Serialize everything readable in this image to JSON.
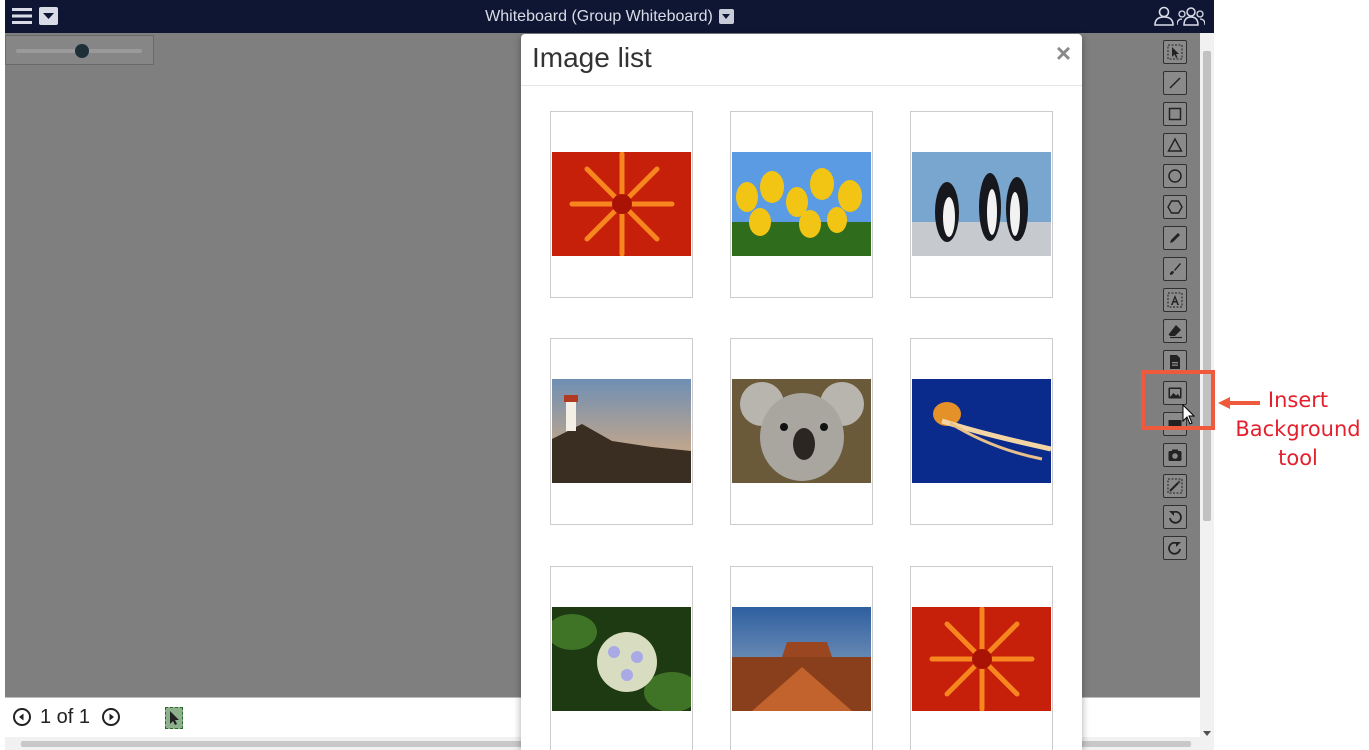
{
  "window": {
    "title": "Whiteboard (Group Whiteboard)"
  },
  "pagination": {
    "label": "1 of 1"
  },
  "zoom": {
    "level": 0.52
  },
  "modal": {
    "title": "Image list",
    "close_glyph": "×",
    "images": [
      {
        "subject": "red dahlia flower"
      },
      {
        "subject": "yellow tulips"
      },
      {
        "subject": "penguins"
      },
      {
        "subject": "lighthouse at sunset"
      },
      {
        "subject": "koala"
      },
      {
        "subject": "jellyfish"
      },
      {
        "subject": "hydrangea"
      },
      {
        "subject": "desert mesa"
      },
      {
        "subject": "red dahlia flower"
      }
    ]
  },
  "toolbar": {
    "tools": [
      "select-icon",
      "line-icon",
      "rectangle-icon",
      "triangle-icon",
      "circle-icon",
      "hexagon-icon",
      "pencil-icon",
      "brush-icon",
      "text-icon",
      "eraser-icon",
      "insert-file-icon",
      "insert-background-icon",
      "insert-image-icon",
      "camera-icon",
      "magic-wand-icon",
      "undo-icon",
      "redo-icon"
    ]
  },
  "annotation": {
    "label_line1": "Insert",
    "label_line2": "Background",
    "label_line3": "tool",
    "color": "#ef5a3c"
  },
  "colors": {
    "topbar": "#0f1634",
    "canvas": "#7f7f7f"
  }
}
